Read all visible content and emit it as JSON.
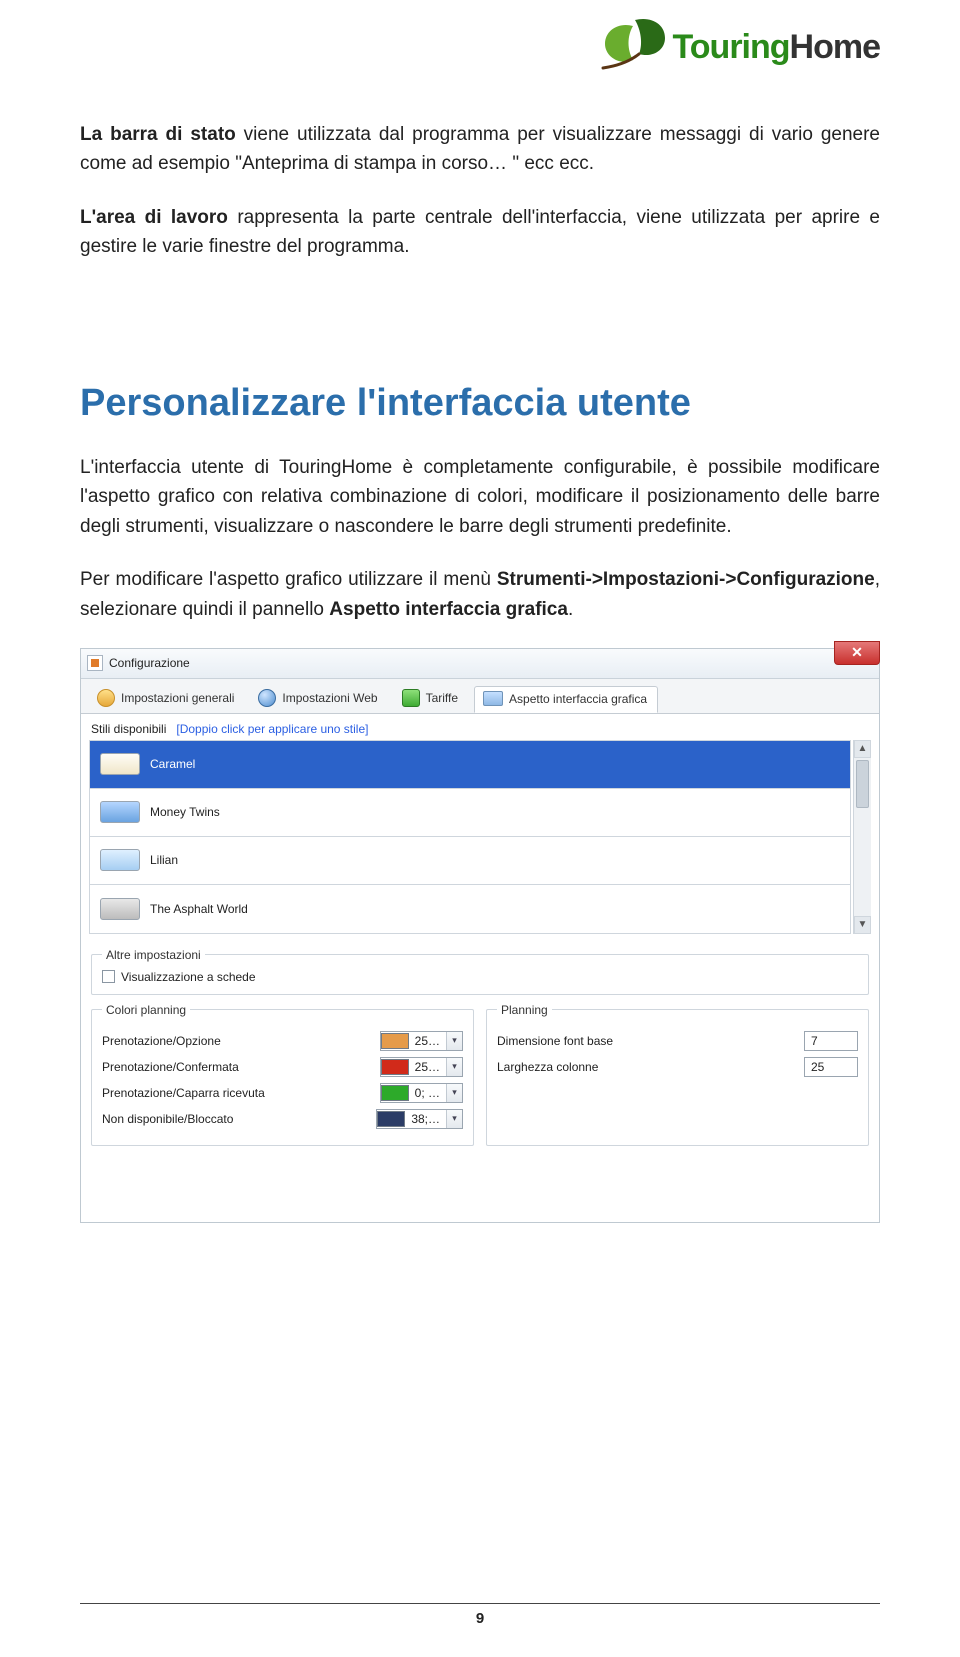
{
  "logo": {
    "brand_left": "Touring",
    "brand_right": "Home"
  },
  "paragraphs": {
    "p1_lead": "La barra di stato",
    "p1_rest": " viene utilizzata dal programma per visualizzare messaggi di vario genere come ad esempio \"Anteprima di stampa in corso… \" ecc ecc.",
    "p2_lead": "L'area di lavoro",
    "p2_rest": " rappresenta la parte centrale dell'interfaccia, viene utilizzata per aprire e gestire le varie finestre del programma."
  },
  "heading": "Personalizzare l'interfaccia utente",
  "body3": "L'interfaccia utente di TouringHome è completamente configurabile, è possibile modificare l'aspetto grafico con relativa combinazione di colori, modificare il posizionamento delle barre degli strumenti, visualizzare o nascondere le barre degli strumenti predefinite.",
  "body4_a": "Per modificare l'aspetto grafico utilizzare il menù ",
  "body4_b": "Strumenti->Impostazioni->Configurazione",
  "body4_c": ", selezionare quindi il pannello ",
  "body4_d": "Aspetto interfaccia grafica",
  "body4_e": ".",
  "window": {
    "title": "Configurazione",
    "tabs": [
      {
        "label": "Impostazioni generali"
      },
      {
        "label": "Impostazioni Web"
      },
      {
        "label": "Tariffe"
      },
      {
        "label": "Aspetto interfaccia grafica"
      }
    ],
    "styles_label": "Stili disponibili",
    "styles_hint": "[Doppio click per applicare uno stile]",
    "styles": [
      {
        "name": "Caramel"
      },
      {
        "name": "Money Twins"
      },
      {
        "name": "Lilian"
      },
      {
        "name": "The Asphalt World"
      }
    ],
    "altre_title": "Altre impostazioni",
    "vis_schede": "Visualizzazione a schede",
    "colori_title": "Colori planning",
    "colori": [
      {
        "label": "Prenotazione/Opzione",
        "value": "25… ",
        "swatch": "c-orange"
      },
      {
        "label": "Prenotazione/Confermata",
        "value": "25… ",
        "swatch": "c-red"
      },
      {
        "label": "Prenotazione/Caparra ricevuta",
        "value": "0; … ",
        "swatch": "c-green"
      },
      {
        "label": "Non disponibile/Bloccato",
        "value": "38;… ",
        "swatch": "c-navy"
      }
    ],
    "planning_title": "Planning",
    "planning": [
      {
        "label": "Dimensione font base",
        "value": "7"
      },
      {
        "label": "Larghezza colonne",
        "value": "25"
      }
    ]
  },
  "page_number": "9"
}
